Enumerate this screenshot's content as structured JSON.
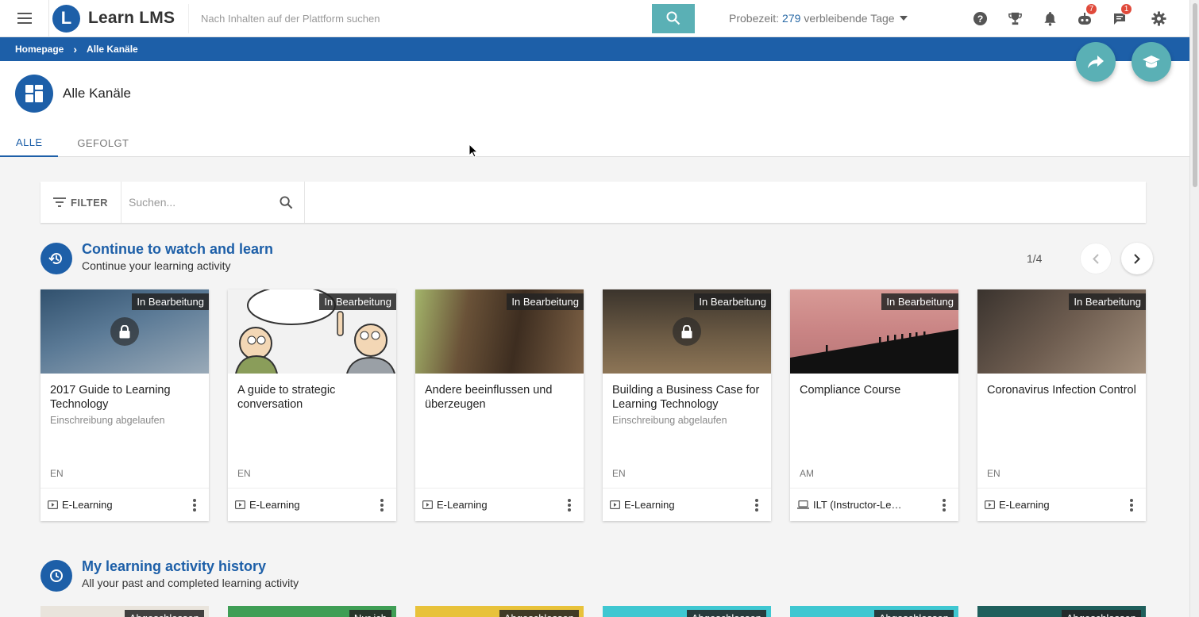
{
  "app": {
    "name": "Learn LMS",
    "logo_letter": "L"
  },
  "search": {
    "placeholder": "Nach Inhalten auf der Plattform suchen"
  },
  "trial": {
    "prefix": "Probezeit:",
    "days": "279",
    "suffix": "verbleibende Tage"
  },
  "top_icons": [
    {
      "name": "help-icon",
      "badge": ""
    },
    {
      "name": "trophy-icon",
      "badge": ""
    },
    {
      "name": "bell-icon",
      "badge": ""
    },
    {
      "name": "bot-icon",
      "badge": "7"
    },
    {
      "name": "chat-icon",
      "badge": "1"
    },
    {
      "name": "gear-icon",
      "badge": ""
    }
  ],
  "breadcrumb": {
    "home": "Homepage",
    "current": "Alle Kanäle"
  },
  "page": {
    "title": "Alle Kanäle"
  },
  "tabs": [
    {
      "label": "ALLE",
      "active": true
    },
    {
      "label": "GEFOLGT",
      "active": false
    }
  ],
  "filter": {
    "label": "FILTER",
    "placeholder": "Suchen..."
  },
  "sections": {
    "continue": {
      "title": "Continue to watch and learn",
      "subtitle": "Continue your learning activity",
      "pager": "1/4"
    },
    "history": {
      "title": "My learning activity history",
      "subtitle": "All your past and completed learning activity"
    }
  },
  "cards": [
    {
      "status": "In Bearbeitung",
      "title": "2017 Guide to Learning Technology",
      "meta": "Einschreibung abgelaufen",
      "lang": "EN",
      "type": "E-Learning",
      "locked": true,
      "thumb_color": "#4a6680"
    },
    {
      "status": "In Bearbeitung",
      "title": "A guide to strategic conversation",
      "meta": "",
      "lang": "EN",
      "type": "E-Learning",
      "locked": false,
      "thumb_color": "#e9e9e9"
    },
    {
      "status": "In Bearbeitung",
      "title": "Andere beeinflussen und überzeugen",
      "meta": "",
      "lang": "",
      "type": "E-Learning",
      "locked": false,
      "thumb_color": "#6b5540"
    },
    {
      "status": "In Bearbeitung",
      "title": "Building a Business Case for Learning Technology",
      "meta": "Einschreibung abgelaufen",
      "lang": "EN",
      "type": "E-Learning",
      "locked": true,
      "thumb_color": "#4f4538"
    },
    {
      "status": "In Bearbeitung",
      "title": "Compliance Course",
      "meta": "",
      "lang": "AM",
      "type": "ILT (Instructor-Led Training)",
      "locked": false,
      "thumb_color": "#b87f82"
    },
    {
      "status": "In Bearbeitung",
      "title": "Coronavirus Infection Control",
      "meta": "",
      "lang": "EN",
      "type": "E-Learning",
      "locked": false,
      "thumb_color": "#5b4e44"
    }
  ],
  "history_cards": [
    {
      "status": "Abgeschlossen",
      "thumb_color": "#e9e4dc"
    },
    {
      "status": "Nur ich",
      "thumb_color": "#3f9e55"
    },
    {
      "status": "Abgeschlossen",
      "thumb_color": "#e8c23a"
    },
    {
      "status": "Abgeschlossen",
      "thumb_color": "#3fc7d1"
    },
    {
      "status": "Abgeschlossen",
      "thumb_color": "#3fc7d1"
    },
    {
      "status": "Abgeschlossen",
      "thumb_color": "#1f5f5c"
    }
  ]
}
